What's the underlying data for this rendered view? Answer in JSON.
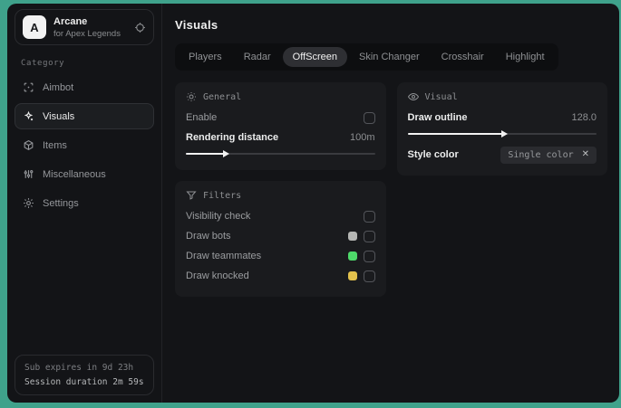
{
  "app": {
    "logo_letter": "A",
    "title": "Arcane",
    "subtitle": "for Apex Legends"
  },
  "sidebar": {
    "category_label": "Category",
    "items": [
      {
        "label": "Aimbot",
        "icon": "target-icon",
        "active": false
      },
      {
        "label": "Visuals",
        "icon": "sparkles-icon",
        "active": true
      },
      {
        "label": "Items",
        "icon": "box-icon",
        "active": false
      },
      {
        "label": "Miscellaneous",
        "icon": "sliders-icon",
        "active": false
      },
      {
        "label": "Settings",
        "icon": "gear-icon",
        "active": false
      }
    ],
    "footer": {
      "sub_expires": "Sub expires in 9d 23h",
      "session_duration": "Session duration 2m 59s"
    }
  },
  "main": {
    "title": "Visuals",
    "active_tab": "OffScreen",
    "tabs": [
      {
        "label": "Players"
      },
      {
        "label": "Radar"
      },
      {
        "label": "OffScreen"
      },
      {
        "label": "Skin Changer"
      },
      {
        "label": "Crosshair"
      },
      {
        "label": "Highlight"
      }
    ]
  },
  "panels": {
    "general": {
      "title": "General",
      "enable_label": "Enable",
      "enable_checked": false,
      "rendering_distance_label": "Rendering distance",
      "rendering_distance_value": "100m",
      "rendering_distance_fill": "20%"
    },
    "visual": {
      "title": "Visual",
      "draw_outline_label": "Draw outline",
      "draw_outline_value": "128.0",
      "draw_outline_fill": "50%",
      "style_color_label": "Style color",
      "style_color_value": "Single color",
      "style_color_clear": "✕"
    },
    "filters": {
      "title": "Filters",
      "rows": [
        {
          "label": "Visibility check",
          "swatch": null,
          "checked": false
        },
        {
          "label": "Draw bots",
          "swatch": "#b5b6b4",
          "checked": false
        },
        {
          "label": "Draw teammates",
          "swatch": "#4ed96a",
          "checked": false
        },
        {
          "label": "Draw knocked",
          "swatch": "#e3c24d",
          "checked": false
        }
      ]
    }
  },
  "colors": {
    "desktop_background": "#3fa28b",
    "window_background": "#131417",
    "panel_background": "#1a1b1e",
    "active_pill": "#2e2f33",
    "slider_fill": "#f2f2f2",
    "swatch_gray": "#b5b6b4",
    "swatch_green": "#4ed96a",
    "swatch_yellow": "#e3c24d"
  }
}
